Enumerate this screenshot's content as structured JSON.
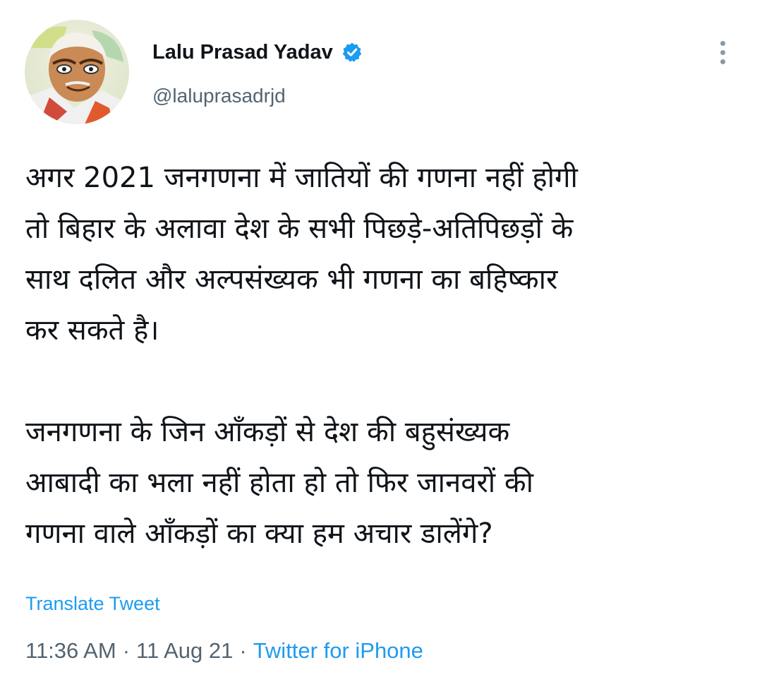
{
  "author": {
    "display_name": "Lalu Prasad Yadav",
    "handle": "@laluprasadrjd",
    "verified_icon": "verified-badge-icon",
    "avatar_icon": "profile-avatar"
  },
  "actions": {
    "more_icon": "more-vertical-icon"
  },
  "tweet": {
    "paragraph1_lines": [
      "अगर 2021 जनगणना में जातियों की गणना नहीं होगी",
      "तो बिहार के अलावा देश के सभी पिछड़े-अतिपिछड़ों के",
      "साथ दलित और अल्पसंख्यक भी गणना का बहिष्कार",
      "कर सकते है।"
    ],
    "paragraph2_lines": [
      "जनगणना के जिन आँकड़ों से देश की बहुसंख्यक",
      "आबादी का भला नहीं होता हो तो फिर जानवरों की",
      "गणना वाले आँकड़ों का क्या हम अचार डालेंगे?"
    ]
  },
  "translate_label": "Translate Tweet",
  "meta": {
    "time": "11:36 AM",
    "separator": "·",
    "date": "11 Aug 21",
    "source": "Twitter for iPhone"
  },
  "colors": {
    "link": "#1d9bf0",
    "secondary_text": "#536471",
    "verified": "#1d9bf0"
  }
}
